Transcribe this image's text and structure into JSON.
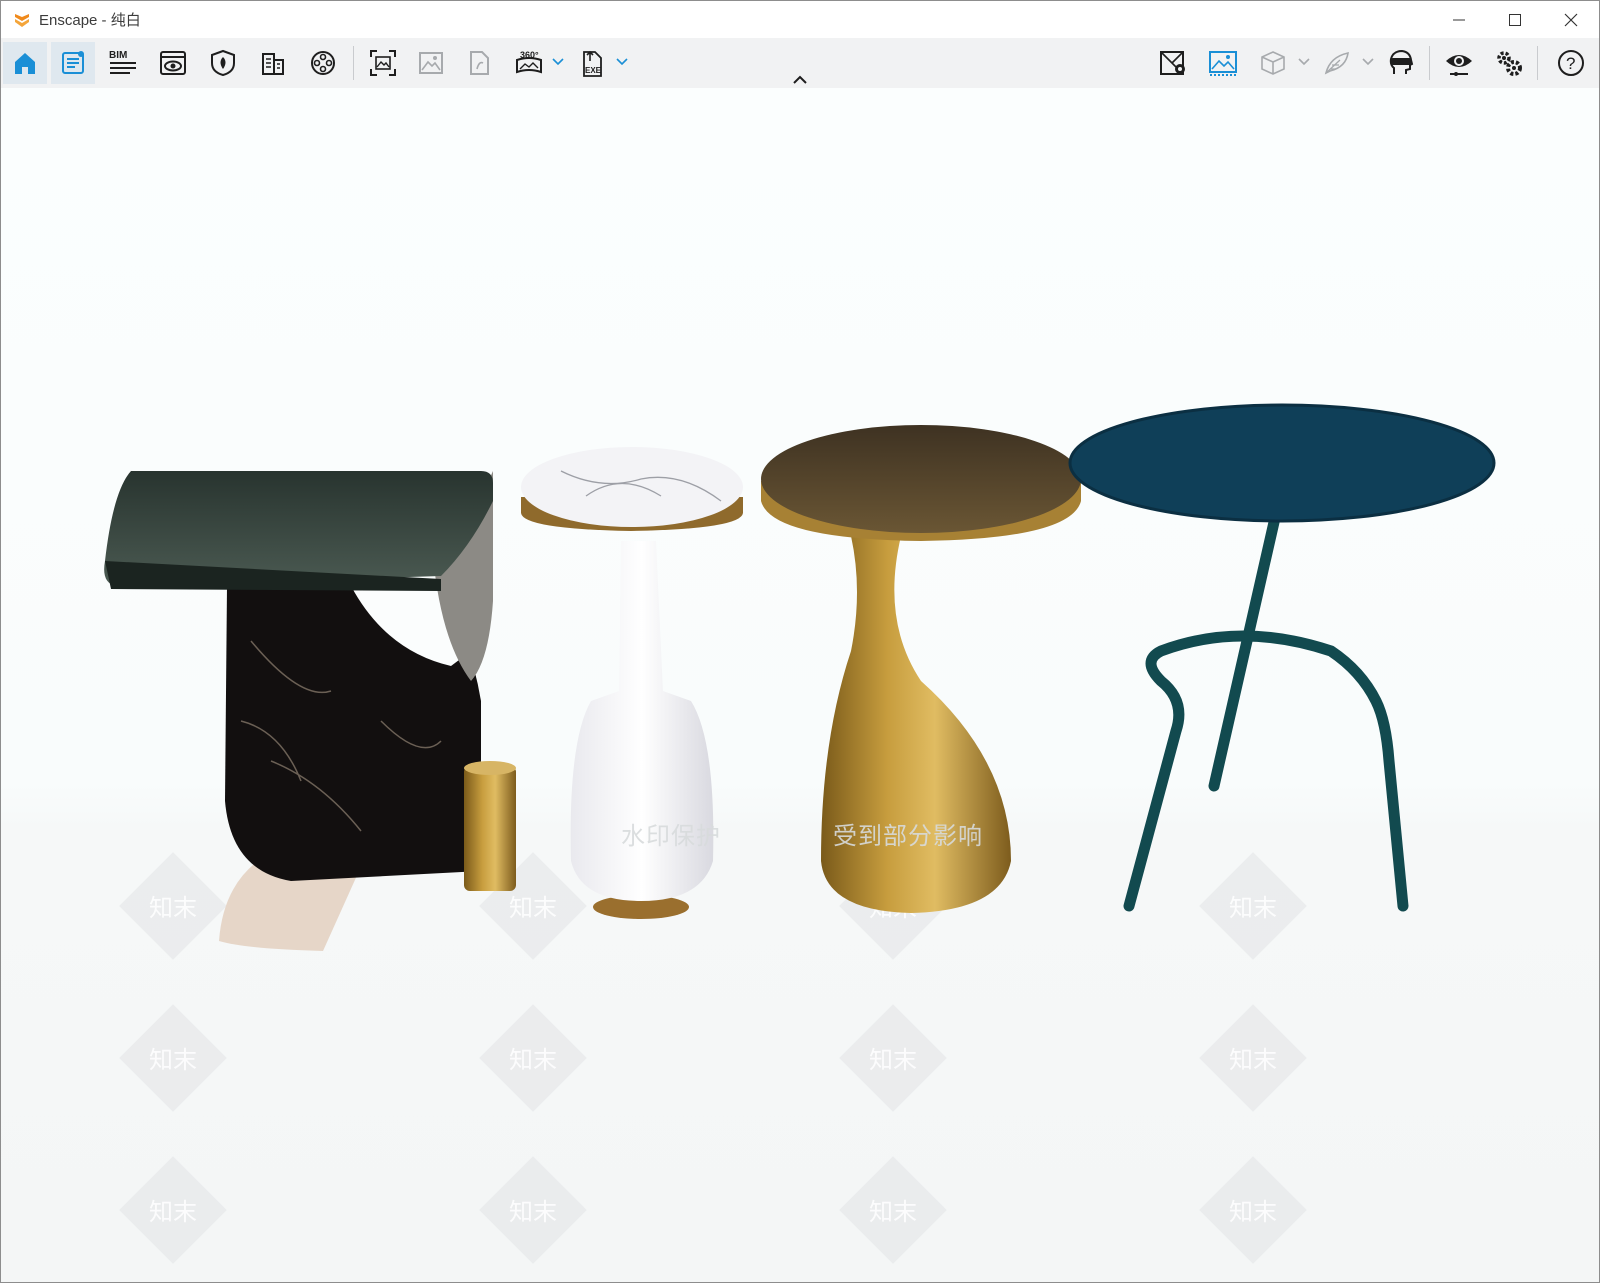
{
  "window": {
    "title": "Enscape - 纯白",
    "controls": [
      "minimize-icon",
      "maximize-icon",
      "close-icon"
    ]
  },
  "toolbar": {
    "left": [
      {
        "name": "home",
        "icon": "home-icon",
        "active": true
      },
      {
        "name": "visual-settings",
        "icon": "notes-icon",
        "active": true
      },
      {
        "name": "bim",
        "icon": "bim-icon",
        "label": "BIM"
      },
      {
        "name": "view-management",
        "icon": "eye-window-icon"
      },
      {
        "name": "asset-library",
        "icon": "shield-leaf-icon"
      },
      {
        "name": "site-context",
        "icon": "buildings-icon"
      },
      {
        "name": "video-editor",
        "icon": "film-reel-icon"
      },
      {
        "name": "screenshot",
        "icon": "capture-frame-icon"
      },
      {
        "name": "batch-render",
        "icon": "image-icon"
      },
      {
        "name": "web-standalone",
        "icon": "file-export-icon"
      },
      {
        "name": "panorama",
        "icon": "panorama-icon",
        "label": "360°"
      },
      {
        "name": "export-exe",
        "icon": "exe-file-icon",
        "label": "EXE"
      }
    ],
    "right": [
      {
        "name": "map-view",
        "icon": "map-pin-icon"
      },
      {
        "name": "render-preview",
        "icon": "image-active-icon"
      },
      {
        "name": "cube",
        "icon": "cube-icon"
      },
      {
        "name": "feather",
        "icon": "feather-icon"
      },
      {
        "name": "vr-headset",
        "icon": "vr-head-icon"
      },
      {
        "name": "live-view",
        "icon": "eye-icon"
      },
      {
        "name": "settings",
        "icon": "gears-icon"
      },
      {
        "name": "help",
        "icon": "help-icon",
        "label": "?"
      }
    ]
  },
  "viewport": {
    "watermark_text": "知末",
    "watermark_caption_1": "水印保护",
    "watermark_caption_2": "受到部分影响"
  },
  "colors": {
    "accent": "#1a8fd6",
    "icon": "#1e1e1e",
    "icon_disabled": "#a7aaad",
    "dark_table_top": "#0e3d55",
    "gold": "#b48a2e"
  }
}
